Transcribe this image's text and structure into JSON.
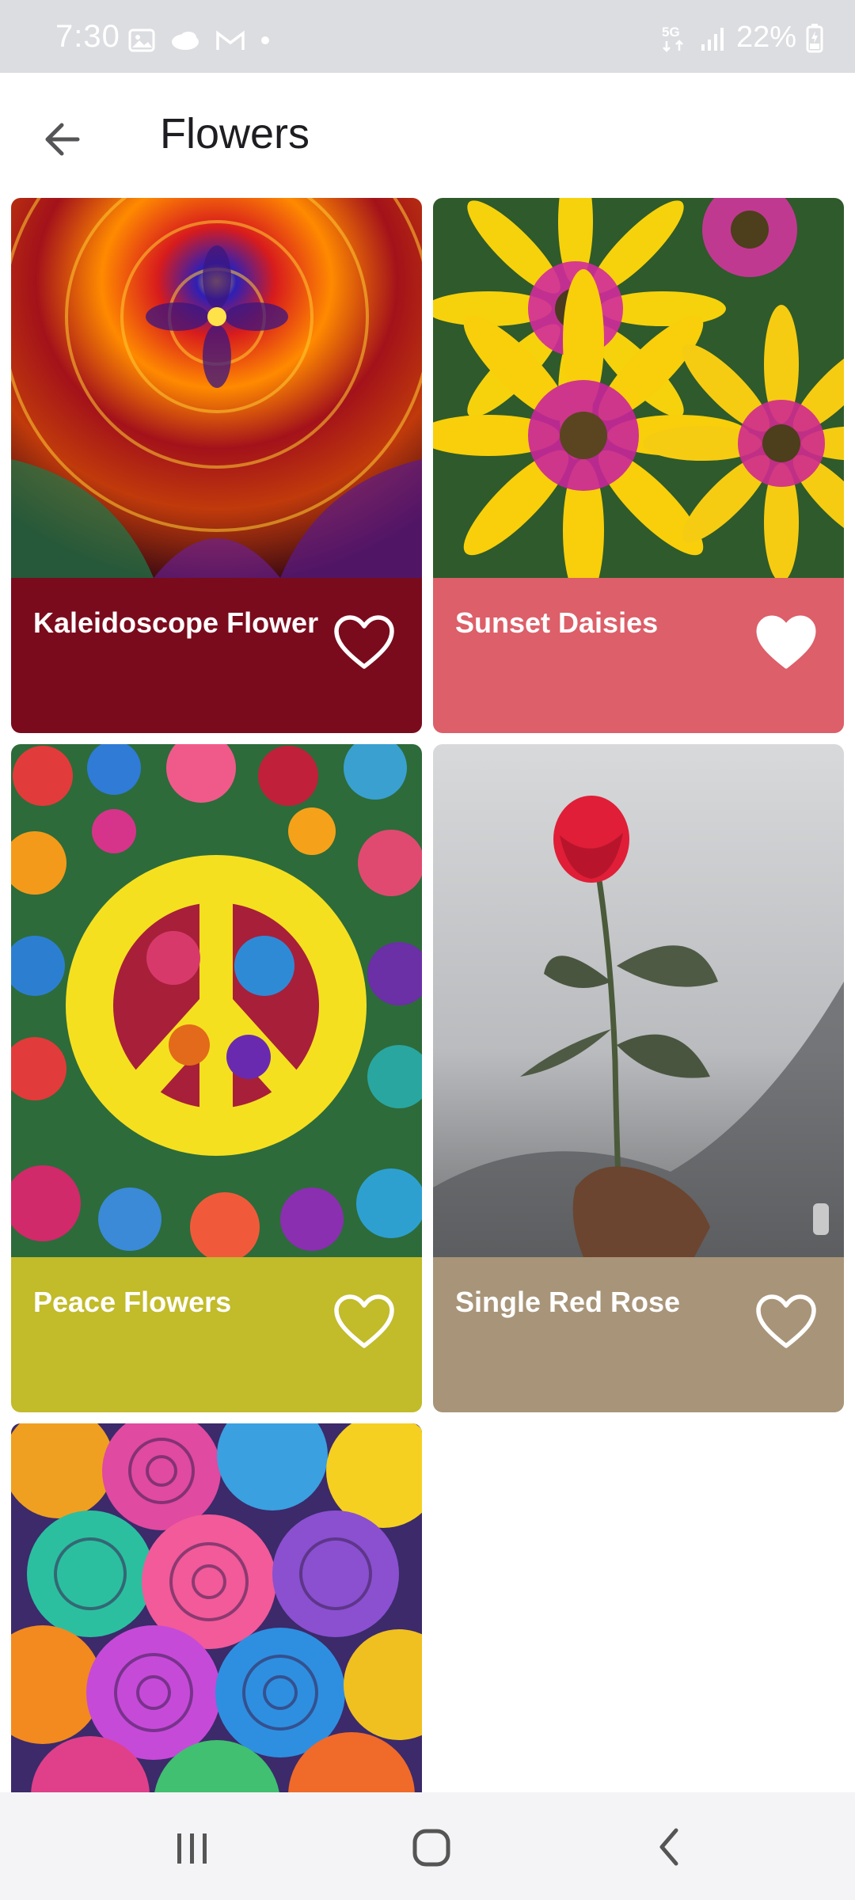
{
  "status_bar": {
    "time": "7:30",
    "icons_left": [
      "gallery-icon",
      "cloud-icon",
      "gmail-icon",
      "dot-icon"
    ],
    "network": "5G",
    "battery": "22%",
    "icons_right": [
      "5g-icon",
      "signal-icon",
      "battery-icon"
    ]
  },
  "app_bar": {
    "title": "Flowers",
    "back_icon": "arrow-left-icon"
  },
  "cards": [
    {
      "title": "Kaleidoscope Flower",
      "footer_color": "#7a0b1d",
      "favorite": false
    },
    {
      "title": "Sunset Daisies",
      "footer_color": "#dc5f69",
      "favorite": true
    },
    {
      "title": "Peace Flowers",
      "footer_color": "#c2bb2a",
      "favorite": false
    },
    {
      "title": "Single Red Rose",
      "footer_color": "#a89478",
      "favorite": false
    },
    {
      "title": "",
      "footer_color": "",
      "favorite": false
    }
  ],
  "nav_bar": {
    "items": [
      "recents-icon",
      "home-icon",
      "back-icon"
    ]
  },
  "colors": {
    "status_bar": "#dcdde1",
    "nav_bar": "#f4f4f6"
  }
}
